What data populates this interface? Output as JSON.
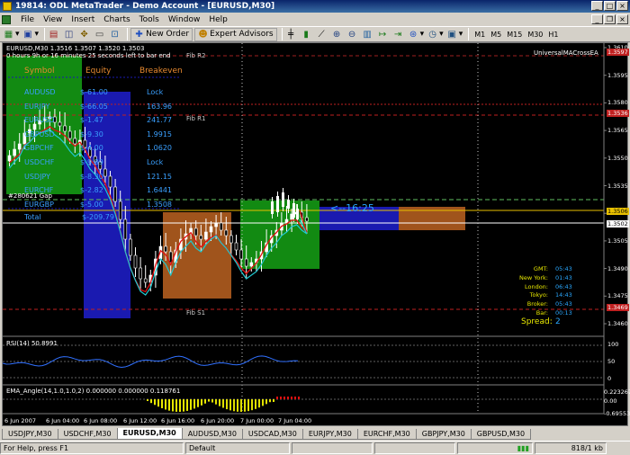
{
  "window": {
    "title": "19814: ODL MetaTrader - Demo Account - [EURUSD,M30]"
  },
  "menu": [
    "File",
    "View",
    "Insert",
    "Charts",
    "Tools",
    "Window",
    "Help"
  ],
  "toolbar": {
    "new_order": "New Order",
    "expert_advisors": "Expert Advisors",
    "timeframes": [
      "M1",
      "M5",
      "M15",
      "M30",
      "H1"
    ]
  },
  "chart": {
    "header": "EURUSD,M30  1.3516 1.3507 1.3520 1.3503",
    "timer": "0 hours 9h or 16 minutes 25 seconds left to bar end",
    "ea_name": "UniversalMACrossEA",
    "countdown": "<--16:25",
    "pivots": [
      "Fib R2",
      "Fib R1",
      "Fib S1"
    ],
    "account_label": "#280621 Gap",
    "table": {
      "headers": [
        "Symbol",
        "Equity",
        "Breakeven"
      ],
      "rows": [
        {
          "symbol": "AUDUSD",
          "equity": "$-61.00",
          "be": "Lock"
        },
        {
          "symbol": "EURJPY",
          "equity": "$-66.05",
          "be": "163.96"
        },
        {
          "symbol": "EURUSD",
          "equity": "$-1.47",
          "be": "241.77"
        },
        {
          "symbol": "GBPUSD",
          "equity": "$-9.30",
          "be": "1.9915"
        },
        {
          "symbol": "GBPCHF",
          "equity": "$-4.00",
          "be": "1.0620"
        },
        {
          "symbol": "USDCHF",
          "equity": "$-9.89",
          "be": "Lock"
        },
        {
          "symbol": "USDJPY",
          "equity": "$-8.30",
          "be": "121.15"
        },
        {
          "symbol": "EURCHF",
          "equity": "$-2.82",
          "be": "1.6441"
        },
        {
          "symbol": "EURGBP",
          "equity": "$-5.00",
          "be": "1.3508"
        }
      ],
      "total_label": "Total",
      "total_value": "$-209.79"
    },
    "clock": {
      "rows": [
        {
          "label": "GMT:",
          "value": "05:43"
        },
        {
          "label": "New York:",
          "value": "01:43"
        },
        {
          "label": "London:",
          "value": "06:43"
        },
        {
          "label": "Tokyo:",
          "value": "14:43"
        },
        {
          "label": "Broker:",
          "value": "05:43"
        },
        {
          "label": "Bar:",
          "value": "00:13"
        }
      ],
      "spread_label": "Spread:",
      "spread_value": "2"
    },
    "price_ticks": [
      "1.3610",
      "1.3595",
      "1.3580",
      "1.3565",
      "1.3550",
      "1.3535",
      "1.3520",
      "1.3505",
      "1.3490",
      "1.3475",
      "1.3460"
    ],
    "price_tags": {
      "top": "1.3597",
      "r1": "1.3536",
      "current": "1.3506",
      "bid": "1.3502",
      "s1": "1.3469"
    },
    "rsi_label": "RSI(14) 50.8991",
    "rsi_ticks": [
      "100",
      "50",
      "0"
    ],
    "ema_label": "EMA_Angle(14,1.0,1.0,2) 0.000000 0.000000 0.118761",
    "ema_ticks": [
      "0.223267",
      "0.00",
      "-0.69553"
    ],
    "time_labels": [
      "6 Jun 2007",
      "6 Jun 04:00",
      "6 Jun 08:00",
      "6 Jun 12:00",
      "6 Jun 16:00",
      "6 Jun 20:00",
      "7 Jun 00:00",
      "7 Jun 04:00"
    ]
  },
  "colors": {
    "bg": "#000000",
    "up_candle": "#ffffff",
    "ema_red": "#e01010",
    "ma_cyan": "#20c8d0",
    "green_box": "#128a12",
    "blue_box": "#1a1ab0",
    "orange_box": "#a0541c",
    "yellow": "#e8e800"
  },
  "tabs": [
    "USDJPY,M30",
    "USDCHF,M30",
    "EURUSD,M30",
    "AUDUSD,M30",
    "USDCAD,M30",
    "EURJPY,M30",
    "EURCHF,M30",
    "GBPJPY,M30",
    "GBPUSD,M30"
  ],
  "active_tab": 2,
  "status": {
    "help": "For Help, press F1",
    "profile": "Default",
    "traffic": "818/1 kb"
  }
}
